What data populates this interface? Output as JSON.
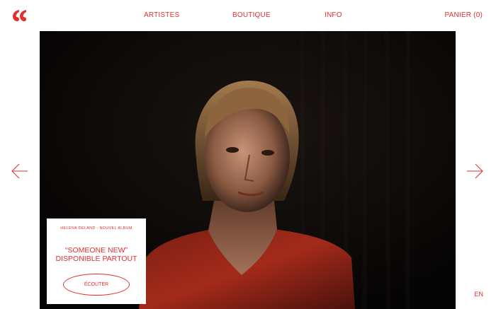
{
  "brand": {
    "logo": "quote-logo-icon",
    "accent": "#e0312f"
  },
  "nav": {
    "artistes": "ARTISTES",
    "boutique": "BOUTIQUE",
    "info": "INFO",
    "cart": "PANIER (0)"
  },
  "hero": {
    "image": "portrait-photo",
    "prev_icon": "arrow-left-icon",
    "next_icon": "arrow-right-icon"
  },
  "card": {
    "eyebrow": "HELENA DELAND - NOUVEL ALBUM",
    "title_line1": "“SOMEONE NEW”",
    "title_line2": "DISPONIBLE PARTOUT",
    "button": "ÉCOUTER"
  },
  "lang": "EN"
}
